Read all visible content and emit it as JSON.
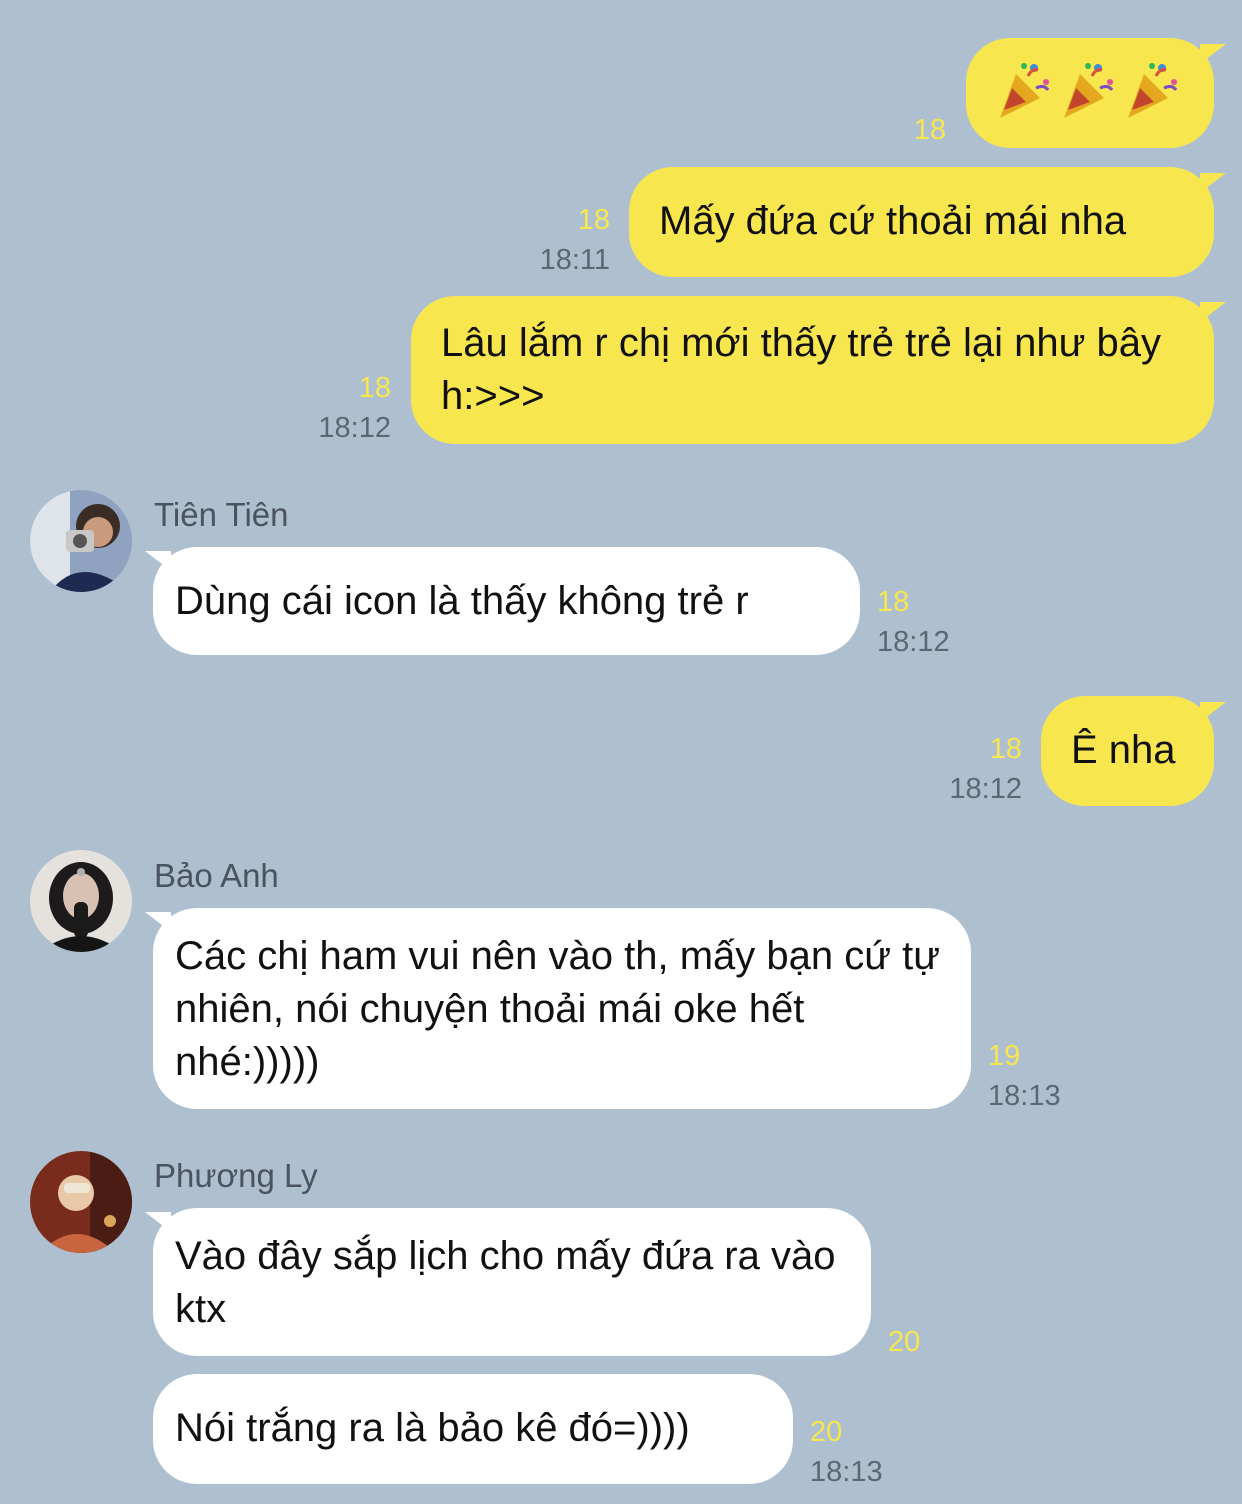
{
  "messages": [
    {
      "sender": "",
      "text": "🎉🎉🎉",
      "read": "18",
      "time": ""
    },
    {
      "sender": "",
      "text": "Mấy đứa cứ thoải mái nha",
      "read": "18",
      "time": "18:11"
    },
    {
      "sender": "",
      "text": "Lâu lắm r chị mới thấy trẻ trẻ lại như bây h:>>>",
      "read": "18",
      "time": "18:12"
    },
    {
      "sender": "Tiên Tiên",
      "text": "Dùng cái icon là thấy không trẻ r",
      "read": "18",
      "time": "18:12"
    },
    {
      "sender": "",
      "text": "Ê nha",
      "read": "18",
      "time": "18:12"
    },
    {
      "sender": "Bảo Anh",
      "text": "Các chị ham vui nên vào th, mấy bạn cứ tự nhiên, nói chuyện thoải mái oke hết nhé:)))))",
      "read": "19",
      "time": "18:13"
    },
    {
      "sender": "Phương Ly",
      "text": "Vào đây sắp lịch cho mấy đứa ra vào ktx",
      "read": "20",
      "time": ""
    },
    {
      "sender": "",
      "text": "Nói trắng ra là bảo kê đó=))))",
      "read": "20",
      "time": "18:13"
    }
  ],
  "icons": {
    "emoji": "party-popper-icon",
    "avatars": [
      "avatar-tien-tien",
      "avatar-bao-anh",
      "avatar-phuong-ly"
    ]
  },
  "colors": {
    "background": "#aec0d0",
    "outgoing_bubble": "#f8e64f",
    "incoming_bubble": "#ffffff",
    "read_count": "#f8e64f",
    "timestamp": "#5d6773",
    "sender_name": "#4a5360"
  }
}
